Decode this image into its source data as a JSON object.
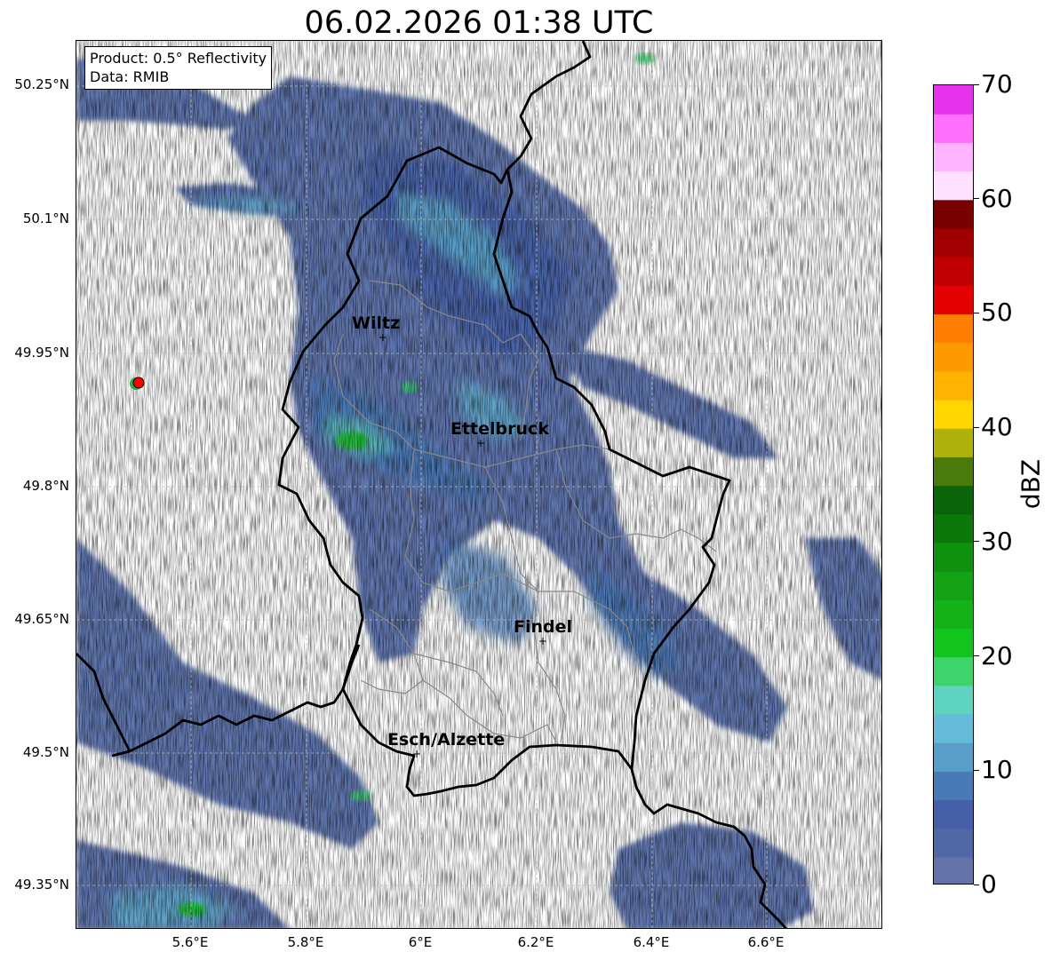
{
  "title": "06.02.2026 01:38 UTC",
  "infobox": {
    "product": "Product: 0.5° Reflectivity",
    "data": "Data: RMIB"
  },
  "axes": {
    "lat_labels": [
      "50.25°N",
      "50.1°N",
      "49.95°N",
      "49.8°N",
      "49.65°N",
      "49.5°N",
      "49.35°N"
    ],
    "lon_labels": [
      "5.6°E",
      "5.8°E",
      "6°E",
      "6.2°E",
      "6.4°E",
      "6.6°E"
    ]
  },
  "cities": [
    {
      "name": "Wiltz"
    },
    {
      "name": "Ettelbruck"
    },
    {
      "name": "Findel"
    },
    {
      "name": "Esch/Alzette"
    }
  ],
  "colorbar": {
    "label": "dBZ",
    "ticks": [
      "0",
      "10",
      "20",
      "30",
      "40",
      "50",
      "60",
      "70"
    ],
    "colors": [
      "#6373a8",
      "#5068a6",
      "#4560a8",
      "#4a7ab6",
      "#589ec8",
      "#64bcd8",
      "#5ed4c0",
      "#3ed46c",
      "#12c41c",
      "#14b218",
      "#12a214",
      "#10900f",
      "#0c780c",
      "#0a640a",
      "#4a7a0a",
      "#adb10a",
      "#ffd600",
      "#ffb300",
      "#ff9900",
      "#ff7d00",
      "#e20000",
      "#c00000",
      "#a00000",
      "#7a0000",
      "#ffe0ff",
      "#ffb4ff",
      "#ff70ff",
      "#e632ec"
    ]
  },
  "colors": {
    "border": "#000000",
    "canton": "#888888",
    "radar_site": "#ff0000",
    "grid": "#bbbbbb"
  }
}
